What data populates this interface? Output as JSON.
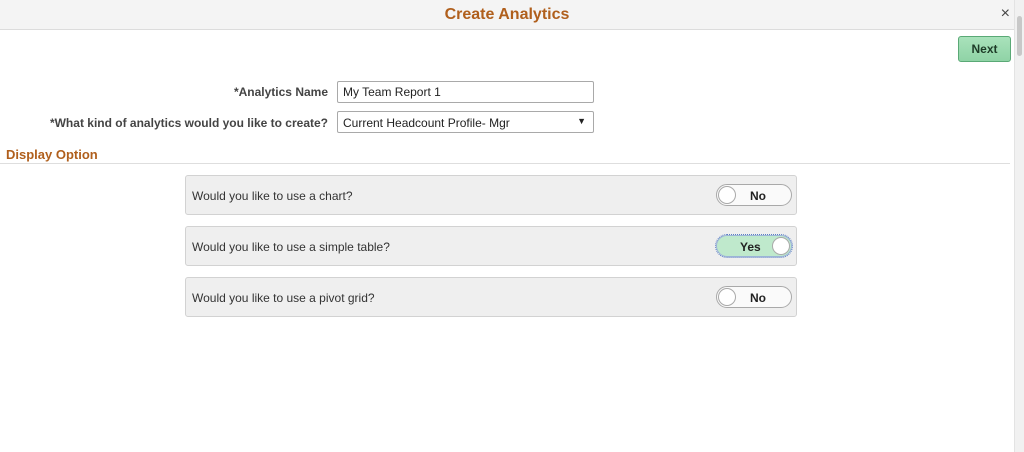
{
  "dialog": {
    "title": "Create Analytics",
    "close_glyph": "×"
  },
  "toolbar": {
    "next_label": "Next"
  },
  "form": {
    "name_label": "*Analytics Name",
    "name_value": "My Team Report 1",
    "kind_label": "*What kind of analytics would you like to create?",
    "kind_value": "Current Headcount Profile- Mgr",
    "kind_arrow": "▼"
  },
  "display": {
    "section_title": "Display Option",
    "options": [
      {
        "label": "Would you like to use a chart?",
        "toggle": "No",
        "on": false
      },
      {
        "label": "Would you like to use a simple table?",
        "toggle": "Yes",
        "on": true
      },
      {
        "label": "Would you like to use a pivot grid?",
        "toggle": "No",
        "on": false
      }
    ]
  },
  "colors": {
    "title": "#b05f1c",
    "next_button": "#8fd3a6",
    "toggle_on": "#bfe9cc"
  },
  "icons": {
    "close": "close-icon",
    "dropdown": "chevron-down-icon"
  }
}
